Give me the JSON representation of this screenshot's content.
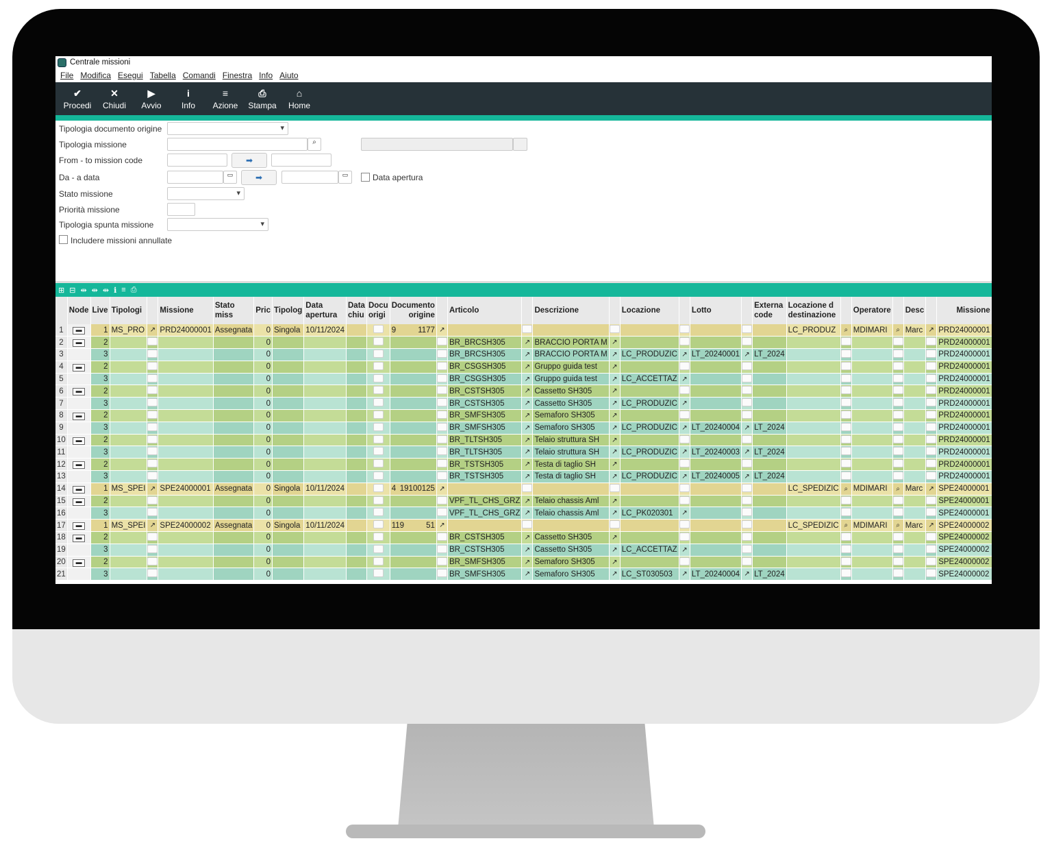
{
  "window": {
    "title": "Centrale missioni"
  },
  "menu": [
    "File",
    "Modifica",
    "Esegui",
    "Tabella",
    "Comandi",
    "Finestra",
    "Info",
    "Aiuto"
  ],
  "toolbar": [
    {
      "label": "Procedi",
      "glyph": "✔"
    },
    {
      "label": "Chiudi",
      "glyph": "✕"
    },
    {
      "label": "Avvio",
      "glyph": "▶"
    },
    {
      "label": "Info",
      "glyph": "i"
    },
    {
      "label": "Azione",
      "glyph": "≡"
    },
    {
      "label": "Stampa",
      "glyph": "⎙"
    },
    {
      "label": "Home",
      "glyph": "⌂"
    }
  ],
  "filters": {
    "tipologia_doc": "Tipologia documento origine",
    "tipologia_missione": "Tipologia missione",
    "from_to": "From - to mission code",
    "da_a_data": "Da - a data",
    "data_apertura": "Data apertura",
    "stato": "Stato missione",
    "priorita": "Priorità missione",
    "spunta": "Tipologia spunta missione",
    "annullate": "Includere missioni annullate"
  },
  "columns": [
    "",
    "Node",
    "Live",
    "Tipologi",
    "",
    "Missione",
    "Stato miss",
    "Pric",
    "Tipolog",
    "Data\napertura",
    "Data\nchiu",
    "Docu\norigi",
    "Documento\norigine",
    "",
    "Articolo",
    "",
    "Descrizione",
    "",
    "Locazione",
    "",
    "Lotto",
    "",
    "Externa\ncode",
    "Locazione d\ndestinazione",
    "",
    "Operatore",
    "",
    "Desc",
    "",
    "Missione"
  ],
  "rows": [
    {
      "n": "1",
      "node": true,
      "lvl": "1",
      "tip": "MS_PRO",
      "mis": "PRD24000001",
      "stato": "Assegnata",
      "pri": "0",
      "tipol": "Singola",
      "data": "10/11/2024",
      "doc1": "9",
      "doc2": "1177",
      "art": "",
      "desc": "",
      "loc": "",
      "lotto": "",
      "ext": "",
      "locd": "LC_PRODUZ",
      "oper": "MDIMARI",
      "dsc": "Marc",
      "mis2": "PRD24000001"
    },
    {
      "n": "2",
      "node": true,
      "lvl": "2",
      "tip": "",
      "mis": "",
      "stato": "",
      "pri": "0",
      "tipol": "",
      "data": "",
      "doc1": "",
      "doc2": "",
      "art": "BR_BRCSH305",
      "desc": "BRACCIO PORTA M",
      "loc": "",
      "lotto": "",
      "ext": "",
      "locd": "",
      "oper": "",
      "dsc": "",
      "mis2": "PRD24000001"
    },
    {
      "n": "3",
      "node": false,
      "lvl": "3",
      "tip": "",
      "mis": "",
      "stato": "",
      "pri": "0",
      "tipol": "",
      "data": "",
      "doc1": "",
      "doc2": "",
      "art": "BR_BRCSH305",
      "desc": "BRACCIO PORTA M",
      "loc": "LC_PRODUZIC",
      "lotto": "LT_20240001",
      "ext": "LT_2024",
      "locd": "",
      "oper": "",
      "dsc": "",
      "mis2": "PRD24000001"
    },
    {
      "n": "4",
      "node": true,
      "lvl": "2",
      "tip": "",
      "mis": "",
      "stato": "",
      "pri": "0",
      "tipol": "",
      "data": "",
      "doc1": "",
      "doc2": "",
      "art": "BR_CSGSH305",
      "desc": "Gruppo guida test",
      "loc": "",
      "lotto": "",
      "ext": "",
      "locd": "",
      "oper": "",
      "dsc": "",
      "mis2": "PRD24000001"
    },
    {
      "n": "5",
      "node": false,
      "lvl": "3",
      "tip": "",
      "mis": "",
      "stato": "",
      "pri": "0",
      "tipol": "",
      "data": "",
      "doc1": "",
      "doc2": "",
      "art": "BR_CSGSH305",
      "desc": "Gruppo guida test",
      "loc": "LC_ACCETTAZ",
      "lotto": "",
      "ext": "",
      "locd": "",
      "oper": "",
      "dsc": "",
      "mis2": "PRD24000001"
    },
    {
      "n": "6",
      "node": true,
      "lvl": "2",
      "tip": "",
      "mis": "",
      "stato": "",
      "pri": "0",
      "tipol": "",
      "data": "",
      "doc1": "",
      "doc2": "",
      "art": "BR_CSTSH305",
      "desc": "Cassetto SH305",
      "loc": "",
      "lotto": "",
      "ext": "",
      "locd": "",
      "oper": "",
      "dsc": "",
      "mis2": "PRD24000001"
    },
    {
      "n": "7",
      "node": false,
      "lvl": "3",
      "tip": "",
      "mis": "",
      "stato": "",
      "pri": "0",
      "tipol": "",
      "data": "",
      "doc1": "",
      "doc2": "",
      "art": "BR_CSTSH305",
      "desc": "Cassetto SH305",
      "loc": "LC_PRODUZIC",
      "lotto": "",
      "ext": "",
      "locd": "",
      "oper": "",
      "dsc": "",
      "mis2": "PRD24000001"
    },
    {
      "n": "8",
      "node": true,
      "lvl": "2",
      "tip": "",
      "mis": "",
      "stato": "",
      "pri": "0",
      "tipol": "",
      "data": "",
      "doc1": "",
      "doc2": "",
      "art": "BR_SMFSH305",
      "desc": "Semaforo SH305",
      "loc": "",
      "lotto": "",
      "ext": "",
      "locd": "",
      "oper": "",
      "dsc": "",
      "mis2": "PRD24000001"
    },
    {
      "n": "9",
      "node": false,
      "lvl": "3",
      "tip": "",
      "mis": "",
      "stato": "",
      "pri": "0",
      "tipol": "",
      "data": "",
      "doc1": "",
      "doc2": "",
      "art": "BR_SMFSH305",
      "desc": "Semaforo SH305",
      "loc": "LC_PRODUZIC",
      "lotto": "LT_20240004",
      "ext": "LT_2024",
      "locd": "",
      "oper": "",
      "dsc": "",
      "mis2": "PRD24000001"
    },
    {
      "n": "10",
      "node": true,
      "lvl": "2",
      "tip": "",
      "mis": "",
      "stato": "",
      "pri": "0",
      "tipol": "",
      "data": "",
      "doc1": "",
      "doc2": "",
      "art": "BR_TLTSH305",
      "desc": "Telaio struttura SH",
      "loc": "",
      "lotto": "",
      "ext": "",
      "locd": "",
      "oper": "",
      "dsc": "",
      "mis2": "PRD24000001"
    },
    {
      "n": "11",
      "node": false,
      "lvl": "3",
      "tip": "",
      "mis": "",
      "stato": "",
      "pri": "0",
      "tipol": "",
      "data": "",
      "doc1": "",
      "doc2": "",
      "art": "BR_TLTSH305",
      "desc": "Telaio struttura SH",
      "loc": "LC_PRODUZIC",
      "lotto": "LT_20240003",
      "ext": "LT_2024",
      "locd": "",
      "oper": "",
      "dsc": "",
      "mis2": "PRD24000001"
    },
    {
      "n": "12",
      "node": true,
      "lvl": "2",
      "tip": "",
      "mis": "",
      "stato": "",
      "pri": "0",
      "tipol": "",
      "data": "",
      "doc1": "",
      "doc2": "",
      "art": "BR_TSTSH305",
      "desc": "Testa di taglio SH",
      "loc": "",
      "lotto": "",
      "ext": "",
      "locd": "",
      "oper": "",
      "dsc": "",
      "mis2": "PRD24000001"
    },
    {
      "n": "13",
      "node": false,
      "lvl": "3",
      "tip": "",
      "mis": "",
      "stato": "",
      "pri": "0",
      "tipol": "",
      "data": "",
      "doc1": "",
      "doc2": "",
      "art": "BR_TSTSH305",
      "desc": "Testa di taglio SH",
      "loc": "LC_PRODUZIC",
      "lotto": "LT_20240005",
      "ext": "LT_2024",
      "locd": "",
      "oper": "",
      "dsc": "",
      "mis2": "PRD24000001"
    },
    {
      "n": "14",
      "node": true,
      "lvl": "1",
      "tip": "MS_SPEI",
      "mis": "SPE24000001",
      "stato": "Assegnata",
      "pri": "0",
      "tipol": "Singola",
      "data": "10/11/2024",
      "doc1": "4",
      "doc2": "19100125",
      "art": "",
      "desc": "",
      "loc": "",
      "lotto": "",
      "ext": "",
      "locd": "LC_SPEDIZIC",
      "oper": "MDIMARI",
      "dsc": "Marc",
      "mis2": "SPE24000001"
    },
    {
      "n": "15",
      "node": true,
      "lvl": "2",
      "tip": "",
      "mis": "",
      "stato": "",
      "pri": "0",
      "tipol": "",
      "data": "",
      "doc1": "",
      "doc2": "",
      "art": "VPF_TL_CHS_GRZ",
      "desc": "Telaio chassis Aml",
      "loc": "",
      "lotto": "",
      "ext": "",
      "locd": "",
      "oper": "",
      "dsc": "",
      "mis2": "SPE24000001"
    },
    {
      "n": "16",
      "node": false,
      "lvl": "3",
      "tip": "",
      "mis": "",
      "stato": "",
      "pri": "0",
      "tipol": "",
      "data": "",
      "doc1": "",
      "doc2": "",
      "art": "VPF_TL_CHS_GRZ",
      "desc": "Telaio chassis Aml",
      "loc": "LC_PK020301",
      "lotto": "",
      "ext": "",
      "locd": "",
      "oper": "",
      "dsc": "",
      "mis2": "SPE24000001"
    },
    {
      "n": "17",
      "node": true,
      "lvl": "1",
      "tip": "MS_SPEI",
      "mis": "SPE24000002",
      "stato": "Assegnata",
      "pri": "0",
      "tipol": "Singola",
      "data": "10/11/2024",
      "doc1": "119",
      "doc2": "51",
      "art": "",
      "desc": "",
      "loc": "",
      "lotto": "",
      "ext": "",
      "locd": "LC_SPEDIZIC",
      "oper": "MDIMARI",
      "dsc": "Marc",
      "mis2": "SPE24000002"
    },
    {
      "n": "18",
      "node": true,
      "lvl": "2",
      "tip": "",
      "mis": "",
      "stato": "",
      "pri": "0",
      "tipol": "",
      "data": "",
      "doc1": "",
      "doc2": "",
      "art": "BR_CSTSH305",
      "desc": "Cassetto SH305",
      "loc": "",
      "lotto": "",
      "ext": "",
      "locd": "",
      "oper": "",
      "dsc": "",
      "mis2": "SPE24000002"
    },
    {
      "n": "19",
      "node": false,
      "lvl": "3",
      "tip": "",
      "mis": "",
      "stato": "",
      "pri": "0",
      "tipol": "",
      "data": "",
      "doc1": "",
      "doc2": "",
      "art": "BR_CSTSH305",
      "desc": "Cassetto SH305",
      "loc": "LC_ACCETTAZ",
      "lotto": "",
      "ext": "",
      "locd": "",
      "oper": "",
      "dsc": "",
      "mis2": "SPE24000002"
    },
    {
      "n": "20",
      "node": true,
      "lvl": "2",
      "tip": "",
      "mis": "",
      "stato": "",
      "pri": "0",
      "tipol": "",
      "data": "",
      "doc1": "",
      "doc2": "",
      "art": "BR_SMFSH305",
      "desc": "Semaforo SH305",
      "loc": "",
      "lotto": "",
      "ext": "",
      "locd": "",
      "oper": "",
      "dsc": "",
      "mis2": "SPE24000002"
    },
    {
      "n": "21",
      "node": false,
      "lvl": "3",
      "tip": "",
      "mis": "",
      "stato": "",
      "pri": "0",
      "tipol": "",
      "data": "",
      "doc1": "",
      "doc2": "",
      "art": "BR_SMFSH305",
      "desc": "Semaforo SH305",
      "loc": "LC_ST030503",
      "lotto": "LT_20240004",
      "ext": "LT_2024",
      "locd": "",
      "oper": "",
      "dsc": "",
      "mis2": "SPE24000002"
    }
  ],
  "colors": {
    "toolbar": "#263238",
    "accent": "#15b79a",
    "level1": "#e2d592",
    "level2": "#b4d084",
    "level3": "#9fd4c0"
  }
}
